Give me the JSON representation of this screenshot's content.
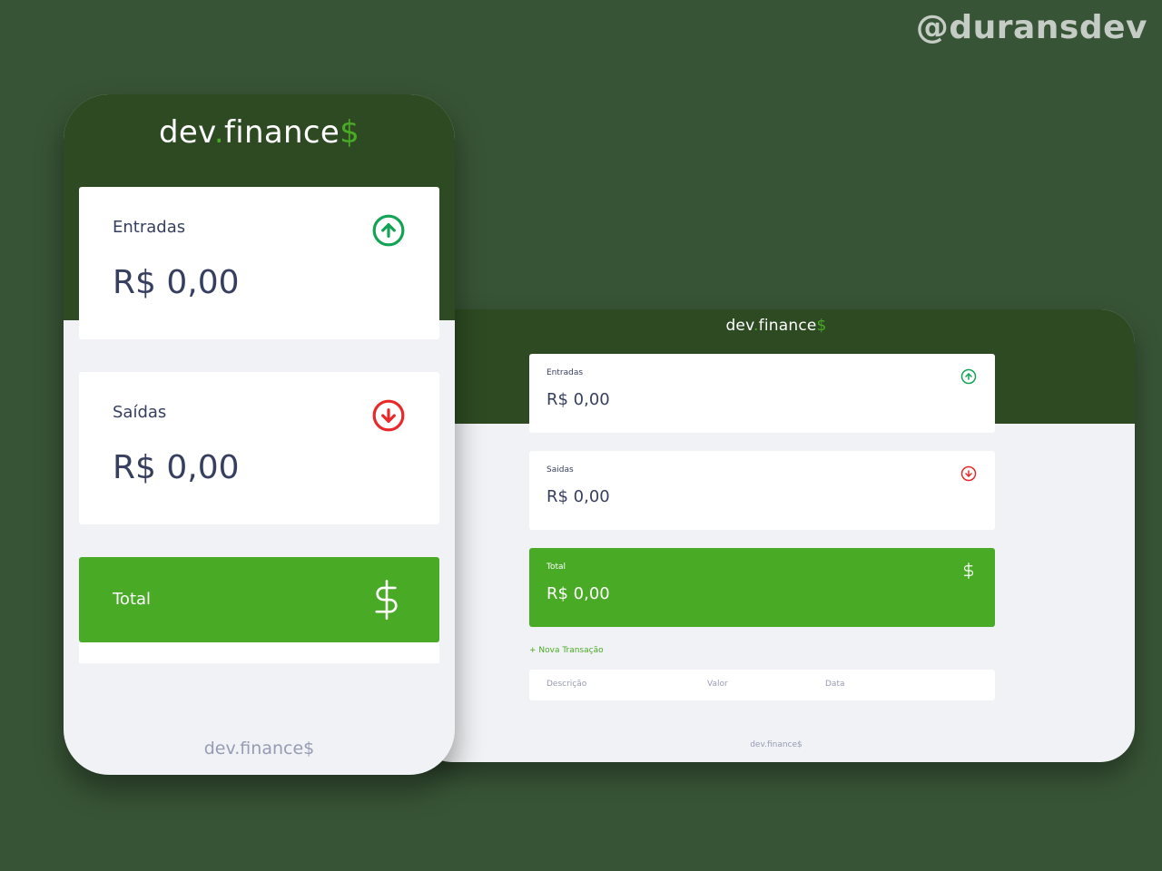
{
  "watermark": "@duransdev",
  "desktop": {
    "logo": {
      "text": "dev",
      "dot": ".",
      "text2": "finance",
      "dollar": "$"
    },
    "cards": {
      "income": {
        "label": "Entradas",
        "value": "R$ 0,00"
      },
      "expense": {
        "label": "Saidas",
        "value": "R$ 0,00"
      },
      "total": {
        "label": "Total",
        "value": "R$ 0,00"
      }
    },
    "new_transaction": "+ Nova Transação",
    "table_headers": {
      "description": "Descrição",
      "amount": "Valor",
      "date": "Data"
    },
    "footer": "dev.finance$"
  },
  "mobile": {
    "logo": {
      "text": "dev",
      "dot": ".",
      "text2": "finance",
      "dollar": "$"
    },
    "cards": {
      "income": {
        "label": "Entradas",
        "value": "R$ 0,00"
      },
      "expense": {
        "label": "Saídas",
        "value": "R$ 0,00"
      },
      "total": {
        "label": "Total"
      }
    },
    "footer": "dev.finance$"
  },
  "colors": {
    "background": "#385436",
    "header": "#2d4a22",
    "accent_green": "#49aa26",
    "income_icon": "#12a454",
    "expense_icon": "#e92929",
    "text": "#363f5f",
    "muted": "#969cb3",
    "surface": "#f0f2f5"
  },
  "icons": {
    "income": "arrow-up-circle-icon",
    "expense": "arrow-down-circle-icon",
    "total": "dollar-sign-icon"
  }
}
